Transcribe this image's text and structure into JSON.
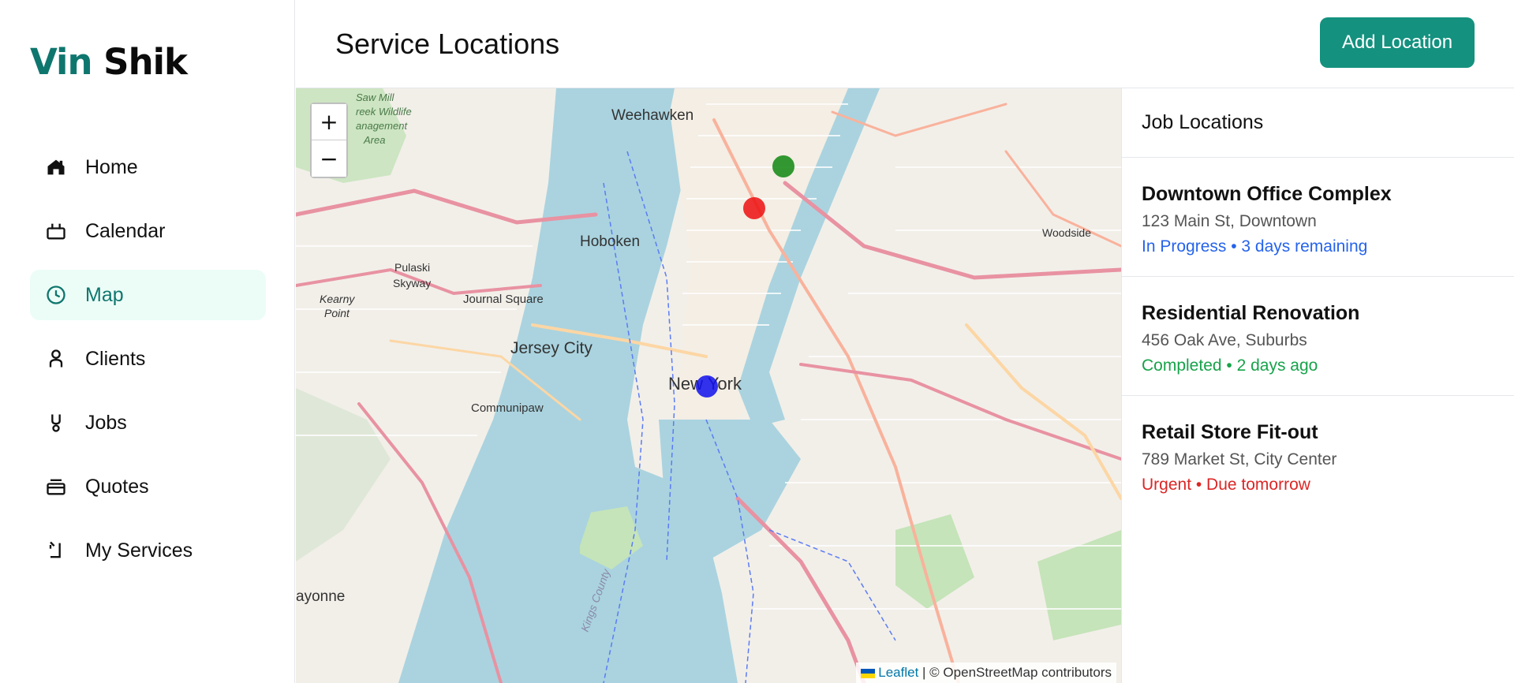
{
  "brand": {
    "first": "Vin",
    "second": "Shik",
    "first_color": "#0f766e"
  },
  "sidebar": {
    "items": [
      {
        "label": "Home",
        "icon": "home-icon",
        "active": false
      },
      {
        "label": "Calendar",
        "icon": "calendar-icon",
        "active": false
      },
      {
        "label": "Map",
        "icon": "clock-icon",
        "active": true
      },
      {
        "label": "Clients",
        "icon": "person-icon",
        "active": false
      },
      {
        "label": "Jobs",
        "icon": "tool-icon",
        "active": false
      },
      {
        "label": "Quotes",
        "icon": "document-icon",
        "active": false
      },
      {
        "label": "My Services",
        "icon": "services-icon",
        "active": false
      }
    ]
  },
  "header": {
    "title": "Service Locations",
    "add_button": "Add Location",
    "accent": "#14917f"
  },
  "map": {
    "zoom_in": "+",
    "zoom_out": "−",
    "labels": {
      "weehawken": "Weehawken",
      "hoboken": "Hoboken",
      "jersey_city": "Jersey City",
      "journal_square": "Journal Square",
      "new_york": "New York",
      "communipaw": "Communipaw",
      "woodside": "Woodside",
      "pulaski": "Pulaski",
      "skyway": "Skyway",
      "kearny": "Kearny",
      "point": "Point",
      "bayonne": "ayonne",
      "kings_county": "Kings County",
      "sawmill": "Saw Mill",
      "creek": "reek Wildlife",
      "management": "anagement",
      "area": "Area"
    },
    "markers": [
      {
        "name": "marker-green",
        "color": "#118811"
      },
      {
        "name": "marker-red",
        "color": "#ee1111"
      },
      {
        "name": "marker-blue",
        "color": "#1111ee"
      }
    ],
    "attribution": {
      "link": "Leaflet",
      "rest": "| © OpenStreetMap contributors"
    }
  },
  "panel": {
    "title": "Job Locations",
    "jobs": [
      {
        "name": "Downtown Office Complex",
        "address": "123 Main St, Downtown",
        "status": "In Progress • 3 days remaining",
        "status_color": "#2563eb"
      },
      {
        "name": "Residential Renovation",
        "address": "456 Oak Ave, Suburbs",
        "status": "Completed • 2 days ago",
        "status_color": "#16a34a"
      },
      {
        "name": "Retail Store Fit-out",
        "address": "789 Market St, City Center",
        "status": "Urgent • Due tomorrow",
        "status_color": "#dc2626"
      }
    ]
  }
}
